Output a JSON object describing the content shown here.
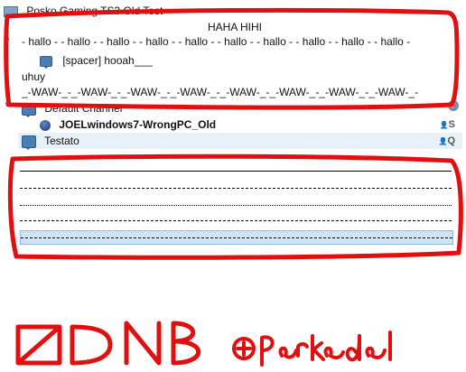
{
  "server": {
    "name": "Posko Gaming TS3 Old Test"
  },
  "spacers": {
    "title": "HAHA HIHI",
    "hallo_line": "- hallo - - hallo - - hallo - - hallo - - hallo - - hallo - - hallo - - hallo - - hallo - - hallo -",
    "spacer_hooah": "[spacer] hooah___",
    "uhuy": "uhuy",
    "waw_line": "_-WAW-_-_-WAW-_-_-WAW-_-_-WAW-_-_-WAW-_-_-WAW-_-_-WAW-_-_-WAW-_-"
  },
  "default_channel": {
    "name": "Default Channel",
    "user": "JOELwindows7-WrongPC_Old"
  },
  "testato": {
    "name": "Testato"
  },
  "group_icons": {
    "user_group": "S",
    "testato_group": "Q"
  },
  "annotation": {
    "logo_text": "DNB",
    "tag_text": "+Perkedel"
  },
  "colors": {
    "selection": "#cfe3f6",
    "annotation_red": "#e01010",
    "channel_icon": "#4a7fb5"
  }
}
